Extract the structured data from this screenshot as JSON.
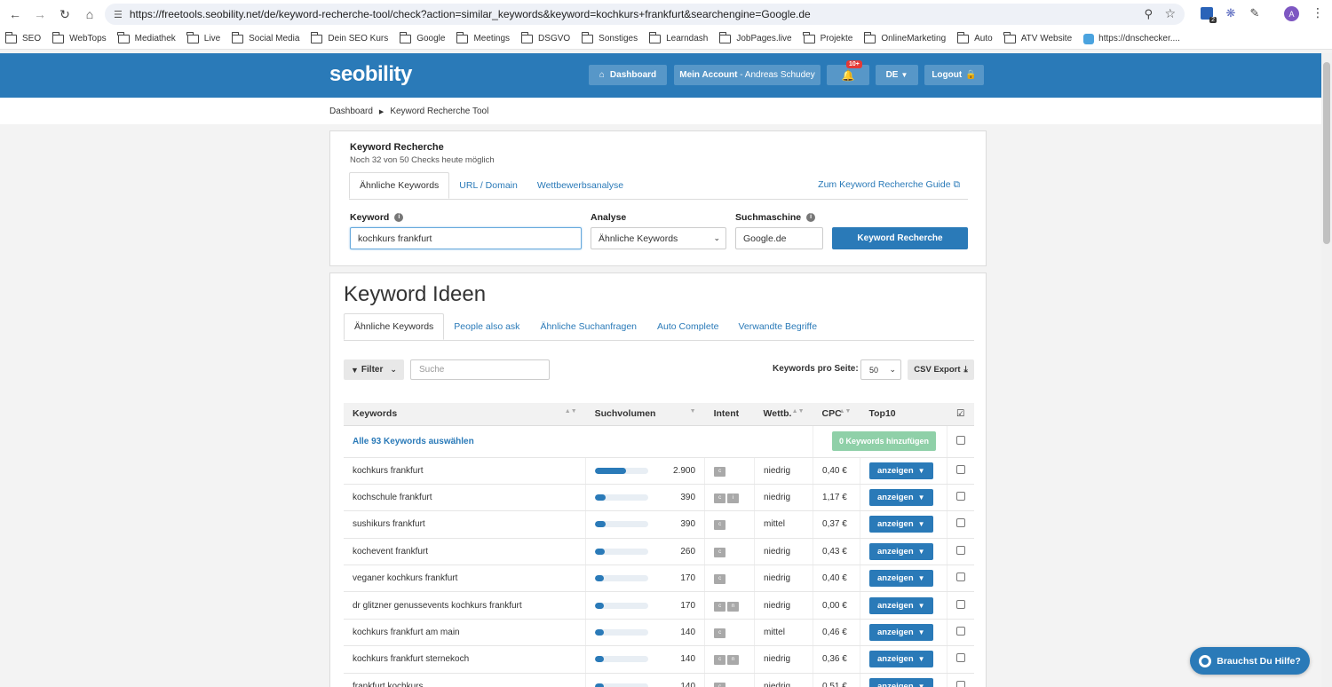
{
  "browser": {
    "url": "https://freetools.seobility.net/de/keyword-recherche-tool/check?action=similar_keywords&keyword=kochkurs+frankfurt&searchengine=Google.de",
    "avatar_letter": "A",
    "ext_badge": "2",
    "bookmarks": [
      "SEO",
      "WebTops",
      "Mediathek",
      "Live",
      "Social Media",
      "Dein SEO Kurs",
      "Google",
      "Meetings",
      "DSGVO",
      "Sonstiges",
      "Learndash",
      "JobPages.live",
      "Projekte",
      "OnlineMarketing",
      "Auto",
      "ATV Website",
      "https://dnschecker...."
    ]
  },
  "header": {
    "logo": "seobility",
    "dashboard": "Dashboard",
    "account_label": "Mein Account",
    "account_user": "- Andreas Schudey",
    "notifications_badge": "10+",
    "language": "DE",
    "logout": "Logout"
  },
  "breadcrumb": {
    "root": "Dashboard",
    "current": "Keyword Recherche Tool"
  },
  "research": {
    "title": "Keyword Recherche",
    "subtitle": "Noch 32 von 50 Checks heute möglich",
    "tabs": [
      "Ähnliche Keywords",
      "URL / Domain",
      "Wettbewerbsanalyse"
    ],
    "guide_link": "Zum Keyword Recherche Guide",
    "keyword_label": "Keyword",
    "keyword_value": "kochkurs frankfurt",
    "analysis_label": "Analyse",
    "analysis_value": "Ähnliche Keywords",
    "engine_label": "Suchmaschine",
    "engine_value": "Google.de",
    "submit": "Keyword Recherche"
  },
  "ideas": {
    "title": "Keyword Ideen",
    "tabs": [
      "Ähnliche Keywords",
      "People also ask",
      "Ähnliche Suchanfragen",
      "Auto Complete",
      "Verwandte Begriffe"
    ],
    "filter": "Filter",
    "search_placeholder": "Suche",
    "per_page_label": "Keywords pro Seite:",
    "per_page_value": "50",
    "csv": "CSV Export",
    "columns": [
      "Keywords",
      "Suchvolumen",
      "Intent",
      "Wettb.",
      "CPC",
      "Top10"
    ],
    "select_all": "Alle 93 Keywords auswählen",
    "add_button": "0 Keywords hinzufügen",
    "show_label": "anzeigen",
    "rows": [
      {
        "keyword": "kochkurs frankfurt",
        "volume": "2.900",
        "volume_share": 0.58,
        "intent": [
          "c"
        ],
        "comp": "niedrig",
        "cpc": "0,40 €"
      },
      {
        "keyword": "kochschule frankfurt",
        "volume": "390",
        "volume_share": 0.2,
        "intent": [
          "c",
          "i"
        ],
        "comp": "niedrig",
        "cpc": "1,17 €"
      },
      {
        "keyword": "sushikurs frankfurt",
        "volume": "390",
        "volume_share": 0.2,
        "intent": [
          "c"
        ],
        "comp": "mittel",
        "cpc": "0,37 €"
      },
      {
        "keyword": "kochevent frankfurt",
        "volume": "260",
        "volume_share": 0.18,
        "intent": [
          "c"
        ],
        "comp": "niedrig",
        "cpc": "0,43 €"
      },
      {
        "keyword": "veganer kochkurs frankfurt",
        "volume": "170",
        "volume_share": 0.16,
        "intent": [
          "c"
        ],
        "comp": "niedrig",
        "cpc": "0,40 €"
      },
      {
        "keyword": "dr glitzner genussevents kochkurs frankfurt",
        "volume": "170",
        "volume_share": 0.16,
        "intent": [
          "c",
          "n"
        ],
        "comp": "niedrig",
        "cpc": "0,00 €"
      },
      {
        "keyword": "kochkurs frankfurt am main",
        "volume": "140",
        "volume_share": 0.16,
        "intent": [
          "c"
        ],
        "comp": "mittel",
        "cpc": "0,46 €"
      },
      {
        "keyword": "kochkurs frankfurt sternekoch",
        "volume": "140",
        "volume_share": 0.16,
        "intent": [
          "c",
          "n"
        ],
        "comp": "niedrig",
        "cpc": "0,36 €"
      },
      {
        "keyword": "frankfurt kochkurs",
        "volume": "140",
        "volume_share": 0.16,
        "intent": [
          "c"
        ],
        "comp": "niedrig",
        "cpc": "0,51 €"
      }
    ]
  },
  "help": "Brauchst Du Hilfe?"
}
